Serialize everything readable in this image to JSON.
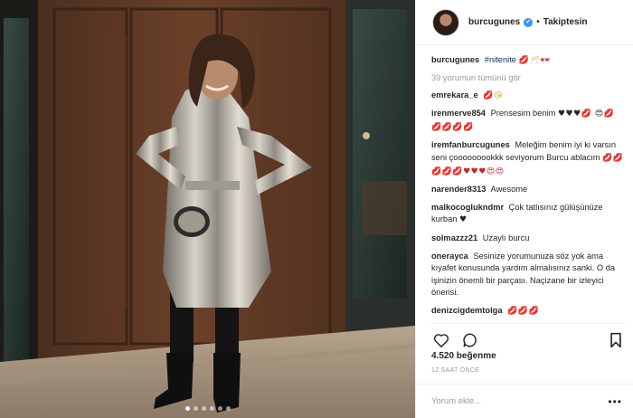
{
  "post": {
    "username": "burcugunes",
    "verified_mark": "✔",
    "separator": "•",
    "follow_state": "Takiptesin",
    "caption": {
      "user": "burcugunes",
      "hashtag": "#nitenite",
      "emojis": "💋🥂🕶"
    },
    "view_all_comments": "39 yorumun tümünü gör",
    "comments": [
      {
        "user": "emrekara_e",
        "text": "",
        "emojis": "💋😘",
        "emoji_color": "yellow"
      },
      {
        "user": "irenmerve854",
        "text": "Prensesim benim",
        "emojis": "♥♥♥💋 😍💋💋💋💋💋",
        "emoji_color": "black"
      },
      {
        "user": "iremfanburcugunes",
        "text": "Meleğim benim iyi ki varsın seni çooooooookkk seviyorum Burcu ablacım",
        "emojis": "💋💋💋💋💋♥♥♥😍😍",
        "emoji_color": "red"
      },
      {
        "user": "narender8313",
        "text": "Awesome",
        "emojis": "",
        "emoji_color": "red"
      },
      {
        "user": "malkocoglukndmr",
        "text": "Çok tatlısınız gülüşünüze kurban",
        "emojis": "♥",
        "emoji_color": "black"
      },
      {
        "user": "solmazzz21",
        "text": "Uzaylı burcu",
        "emojis": "",
        "emoji_color": "red"
      },
      {
        "user": "onerayca",
        "text": "Sesinize yorumunuza söz yok ama kıyafet konusunda yardım almalısınız sanki. O da işinizin önemli bir parçası. Naçizane bir izleyici önerisi.",
        "emojis": "",
        "emoji_color": "red"
      },
      {
        "user": "denizcigdemtolga",
        "text": "",
        "emojis": "💋💋💋",
        "emoji_color": "red"
      }
    ],
    "likes": "4.520 beğenme",
    "time_ago": "12 SAAT ÖNCE",
    "comment_placeholder": "Yorum ekle...",
    "more_options": "•••",
    "carousel": {
      "count": 6,
      "active_index": 0
    },
    "icons": {
      "like": "heart-icon",
      "comment": "speech-bubble-icon",
      "save": "bookmark-icon",
      "verified": "verified-badge-icon"
    },
    "colors": {
      "link": "#003569",
      "verified": "#3897f0",
      "muted": "#999999",
      "text": "#262626"
    }
  }
}
